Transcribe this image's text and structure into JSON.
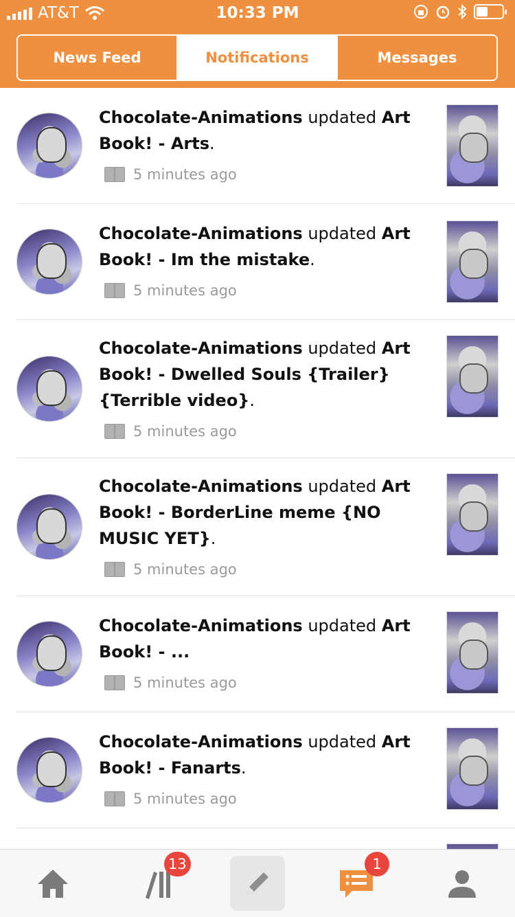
{
  "status_bar": {
    "carrier": "AT&T",
    "time": "10:33 PM"
  },
  "tabs": [
    {
      "label": "News Feed",
      "active": false
    },
    {
      "label": "Notifications",
      "active": true
    },
    {
      "label": "Messages",
      "active": false
    }
  ],
  "notifications": [
    {
      "user": "Chocolate-Animations",
      "action": "updated",
      "title": "Art Book! - Arts",
      "time": "5 minutes ago"
    },
    {
      "user": "Chocolate-Animations",
      "action": "updated",
      "title": "Art Book! - Im the mistake",
      "time": "5 minutes ago"
    },
    {
      "user": "Chocolate-Animations",
      "action": "updated",
      "title": "Art Book! - Dwelled Souls {Trailer} {Terrible video}",
      "time": "5 minutes ago"
    },
    {
      "user": "Chocolate-Animations",
      "action": "updated",
      "title": "Art Book! - BorderLine meme {NO MUSIC YET}",
      "time": "5 minutes ago"
    },
    {
      "user": "Chocolate-Animations",
      "action": "updated",
      "title": "Art Book! - ...",
      "time": "5 minutes ago"
    },
    {
      "user": "Chocolate-Animations",
      "action": "updated",
      "title": "Art Book! - Fanarts",
      "time": "5 minutes ago"
    }
  ],
  "tab_bar": {
    "home_icon": "home-icon",
    "library_icon": "library-icon",
    "library_badge": "13",
    "compose_icon": "pencil-icon",
    "notifications_icon": "notifications-icon",
    "notifications_badge": "1",
    "profile_icon": "profile-icon"
  },
  "colors": {
    "accent": "#ee9040",
    "badge": "#e8453c"
  }
}
